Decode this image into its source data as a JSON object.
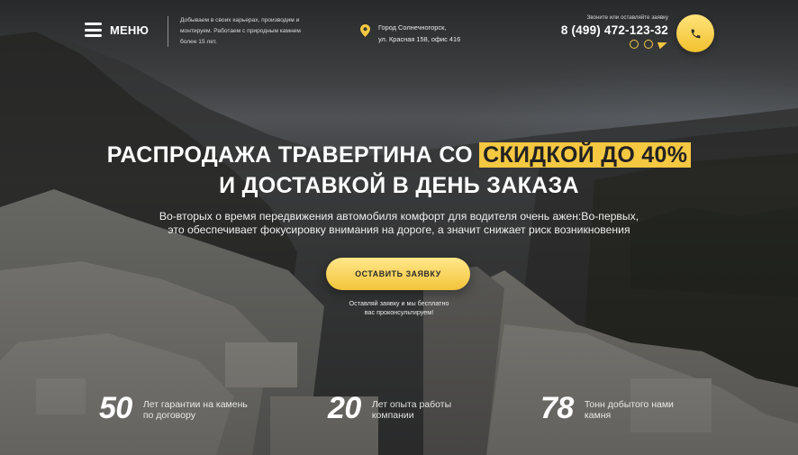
{
  "header": {
    "menu_label": "МЕНЮ",
    "tagline": "Добываем в своих карьерах, производим и монтируем. Работаем с природным камнем более 15 лет.",
    "address_line1": "Город Солнечногорск,",
    "address_line2": "ул. Красная 158, офис 416",
    "call_note": "Звоните или оставляйте заявку",
    "phone": "8 (499) 472-123-32",
    "messengers": [
      "whatsapp-icon",
      "viber-icon",
      "telegram-icon"
    ],
    "accent_color": "#f5c842"
  },
  "hero": {
    "headline_part1": "РАСПРОДАЖА ТРАВЕРТИНА СО ",
    "headline_highlight": "СКИДКОЙ ДО 40%",
    "headline_line2": "И ДОСТАВКОЙ В ДЕНЬ ЗАКАЗА",
    "subtitle_line1": "Во-вторых о время передвижения автомобиля комфорт  для водителя очень ажен:Во-первых,",
    "subtitle_line2": "это обеспечивает фокусировку внимания на дороге, а значит снижает риск возникновения",
    "cta_label": "ОСТАВИТЬ ЗАЯВКУ",
    "cta_note_line1": "Оставляй заявку и мы бесплатно",
    "cta_note_line2": "вас проконсультируем!"
  },
  "stats": [
    {
      "number": "50",
      "line1": "Лет гарантии на камень",
      "line2": "по договору"
    },
    {
      "number": "20",
      "line1": "Лет опыта работы",
      "line2": "компании"
    },
    {
      "number": "78",
      "line1": "Тонн добытого нами",
      "line2": "камня"
    }
  ]
}
